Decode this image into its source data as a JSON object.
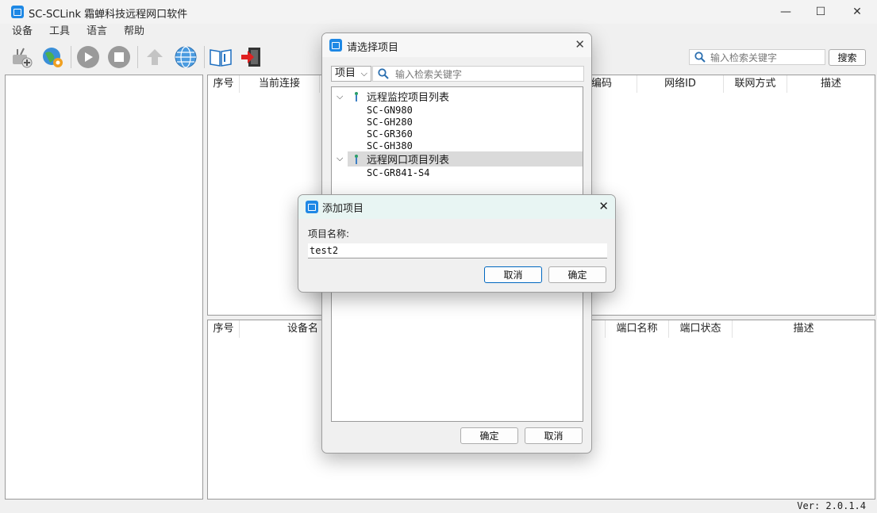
{
  "window": {
    "title": "SC-SCLink 霜蝉科技远程网口软件",
    "controls": {
      "minimize": "—",
      "maximize": "☐",
      "close": "✕"
    }
  },
  "menu": [
    "设备",
    "工具",
    "语言",
    "帮助"
  ],
  "toolbar": {
    "search_placeholder": "输入检索关键字",
    "search_button": "搜索"
  },
  "top_grid": {
    "columns": [
      "序号",
      "当前连接",
      "",
      "",
      "",
      "",
      "",
      "编码",
      "网络ID",
      "联网方式",
      "描述"
    ]
  },
  "bottom_grid": {
    "columns": [
      "序号",
      "设备名",
      "",
      "",
      "",
      "",
      "",
      "端口名称",
      "端口状态",
      "描述"
    ]
  },
  "status": {
    "version": "Ver: 2.0.1.4"
  },
  "select_dialog": {
    "title": "请选择项目",
    "close": "✕",
    "filter_value": "项目",
    "search_placeholder": "输入检索关键字",
    "groups": [
      {
        "label": "远程监控项目列表",
        "items": [
          "SC-GN980",
          "SC-GH280",
          "SC-GR360",
          "SC-GH380"
        ]
      },
      {
        "label": "远程网口项目列表",
        "items": [
          "SC-GR841-S4"
        ]
      }
    ],
    "ok": "确定",
    "cancel": "取消"
  },
  "add_dialog": {
    "title": "添加项目",
    "close": "✕",
    "name_label": "项目名称:",
    "name_value": "test2",
    "cancel": "取消",
    "ok": "确定"
  },
  "colors": {
    "accent": "#0067c0",
    "app_icon": "#1e88e5"
  }
}
